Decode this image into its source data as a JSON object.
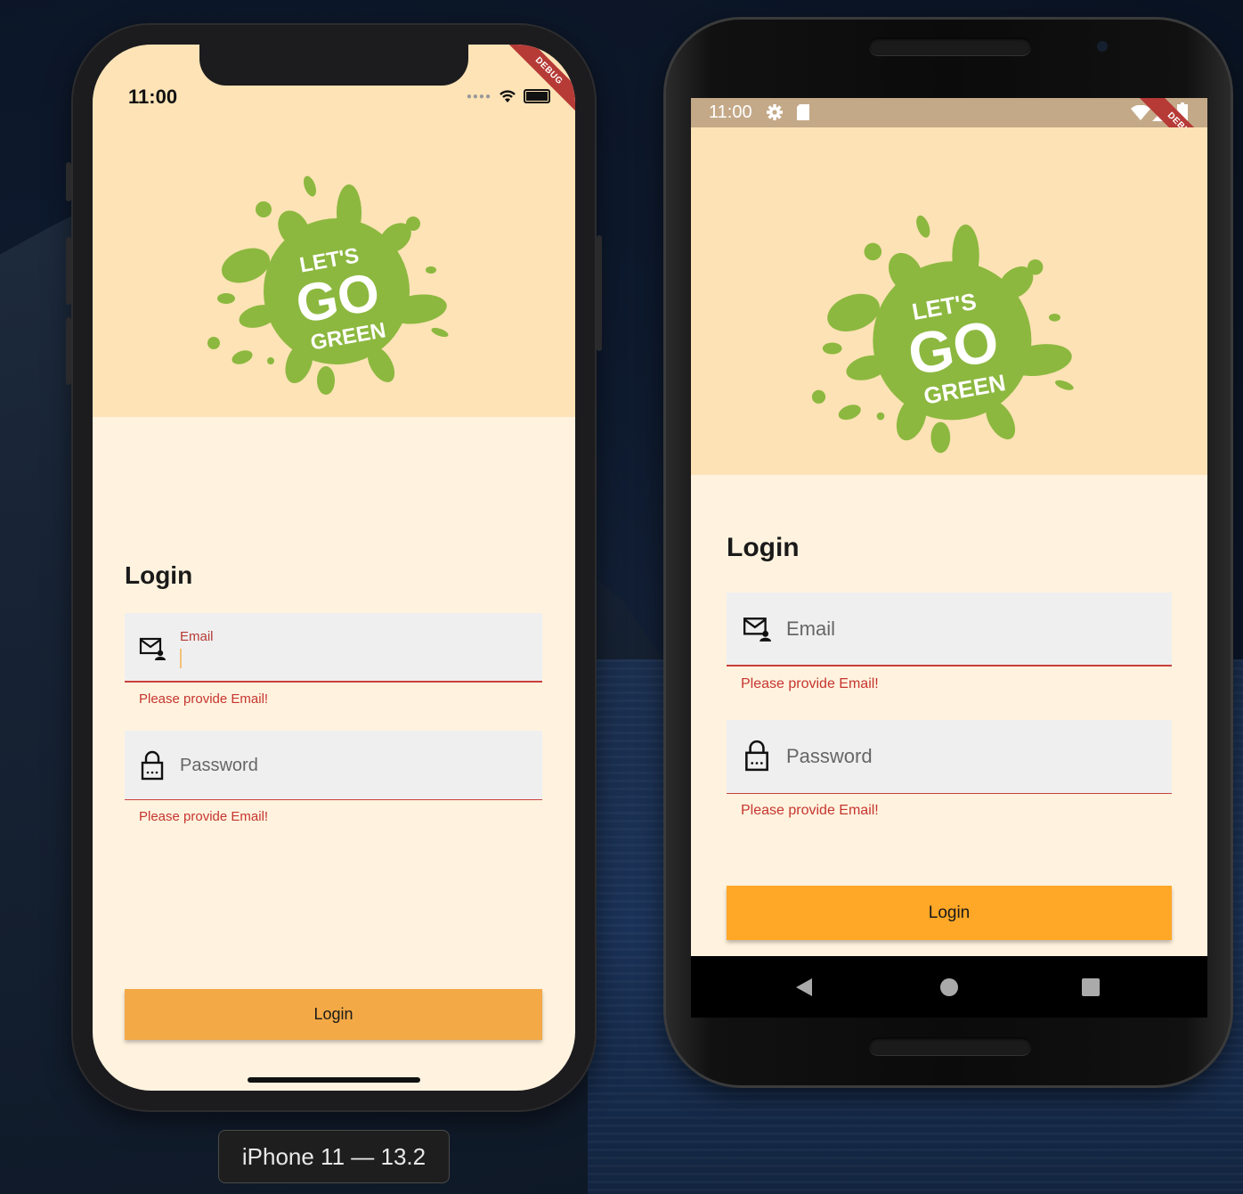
{
  "ios": {
    "status": {
      "time": "11:00"
    },
    "debug_label": "DEBUG",
    "logo": {
      "line1": "LET'S",
      "line2": "GO",
      "line3": "GREEN"
    },
    "login": {
      "title": "Login",
      "email_label": "Email",
      "email_error": "Please provide Email!",
      "password_placeholder": "Password",
      "password_error": "Please provide Email!",
      "button": "Login"
    }
  },
  "device_label": "iPhone 11 — 13.2",
  "android": {
    "status": {
      "time": "11:00"
    },
    "debug_label": "DEBUG",
    "logo": {
      "line1": "LET'S",
      "line2": "GO",
      "line3": "GREEN"
    },
    "login": {
      "title": "Login",
      "email_placeholder": "Email",
      "email_error": "Please provide Email!",
      "password_placeholder": "Password",
      "password_error": "Please provide Email!",
      "button": "Login"
    }
  },
  "colors": {
    "header_bg": "#fde3b6",
    "body_bg": "#fff3df",
    "logo_green": "#8cb83f",
    "error_red": "#c6352f",
    "ios_button": "#f3a945",
    "android_button": "#ffa726"
  }
}
